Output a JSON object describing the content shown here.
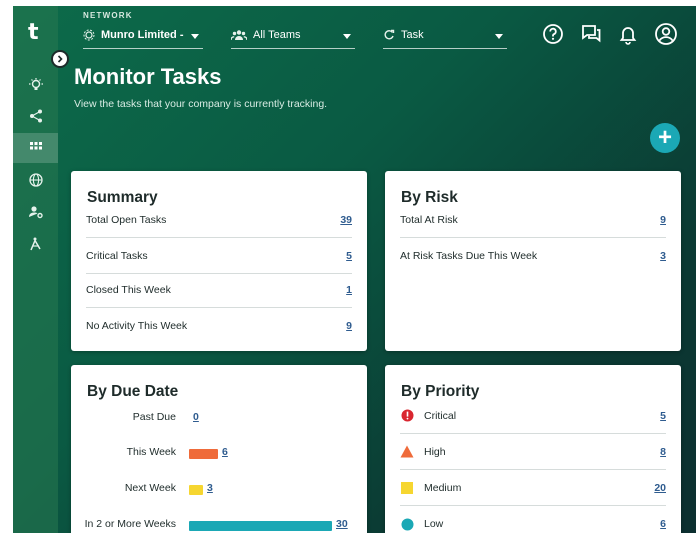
{
  "app": {
    "logo": "t"
  },
  "header": {
    "network_label": "NETWORK",
    "company_select": {
      "value": "Munro Limited -"
    },
    "teams_select": {
      "value": "All Teams"
    },
    "type_select": {
      "value": "Task"
    }
  },
  "page": {
    "title": "Monitor Tasks",
    "subtitle": "View the tasks that your company is currently tracking."
  },
  "summary": {
    "title": "Summary",
    "rows": [
      {
        "label": "Total Open Tasks",
        "value": "39"
      },
      {
        "label": "Critical Tasks",
        "value": "5"
      },
      {
        "label": "Closed This Week",
        "value": "1"
      },
      {
        "label": "No Activity This Week",
        "value": "9"
      }
    ]
  },
  "by_risk": {
    "title": "By Risk",
    "rows": [
      {
        "label": "Total At Risk",
        "value": "9"
      },
      {
        "label": "At Risk Tasks Due This Week",
        "value": "3"
      }
    ]
  },
  "by_due_date": {
    "title": "By Due Date",
    "rows": [
      {
        "label": "Past Due",
        "value": 0,
        "color": "#1ba8b5"
      },
      {
        "label": "This Week",
        "value": 6,
        "color": "#ef6b3a"
      },
      {
        "label": "Next Week",
        "value": 3,
        "color": "#f6d630"
      },
      {
        "label": "In 2 or More Weeks",
        "value": 30,
        "color": "#1ba8b5"
      }
    ],
    "max": 30
  },
  "by_priority": {
    "title": "By Priority",
    "rows": [
      {
        "label": "Critical",
        "value": "5",
        "icon": "critical-exclamation-icon",
        "color": "#d9262f"
      },
      {
        "label": "High",
        "value": "8",
        "icon": "high-triangle-icon",
        "color": "#ef6b3a"
      },
      {
        "label": "Medium",
        "value": "20",
        "icon": "medium-square-icon",
        "color": "#f6d630"
      },
      {
        "label": "Low",
        "value": "6",
        "icon": "low-circle-icon",
        "color": "#1ba8b5"
      }
    ]
  }
}
